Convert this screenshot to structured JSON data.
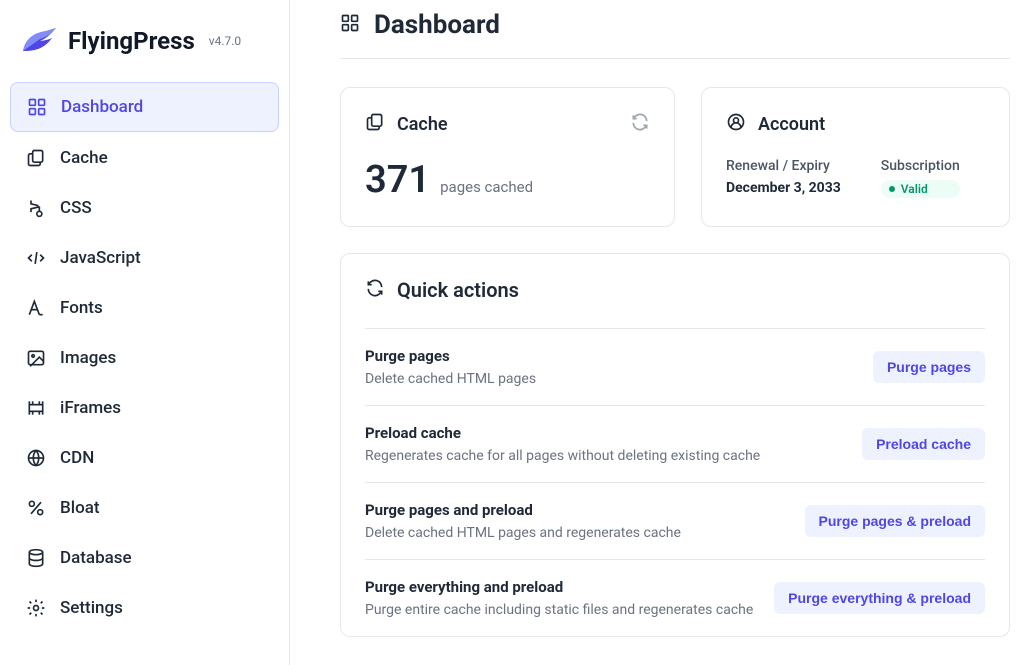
{
  "app": {
    "name": "FlyingPress",
    "version": "v4.7.0"
  },
  "sidebar": {
    "items": [
      {
        "label": "Dashboard",
        "active": true
      },
      {
        "label": "Cache"
      },
      {
        "label": "CSS"
      },
      {
        "label": "JavaScript"
      },
      {
        "label": "Fonts"
      },
      {
        "label": "Images"
      },
      {
        "label": "iFrames"
      },
      {
        "label": "CDN"
      },
      {
        "label": "Bloat"
      },
      {
        "label": "Database"
      },
      {
        "label": "Settings"
      }
    ]
  },
  "page": {
    "title": "Dashboard"
  },
  "cache": {
    "title": "Cache",
    "count": "371",
    "unit": "pages cached"
  },
  "account": {
    "title": "Account",
    "renewal_label": "Renewal / Expiry",
    "renewal_value": "December 3, 2033",
    "subscription_label": "Subscription",
    "subscription_status": "Valid"
  },
  "quick": {
    "title": "Quick actions",
    "actions": [
      {
        "title": "Purge pages",
        "desc": "Delete cached HTML pages",
        "button": "Purge pages"
      },
      {
        "title": "Preload cache",
        "desc": "Regenerates cache for all pages without deleting existing cache",
        "button": "Preload cache"
      },
      {
        "title": "Purge pages and preload",
        "desc": "Delete cached HTML pages and regenerates cache",
        "button": "Purge pages & preload"
      },
      {
        "title": "Purge everything and preload",
        "desc": "Purge entire cache including static files and regenerates cache",
        "button": "Purge everything & preload"
      }
    ]
  }
}
